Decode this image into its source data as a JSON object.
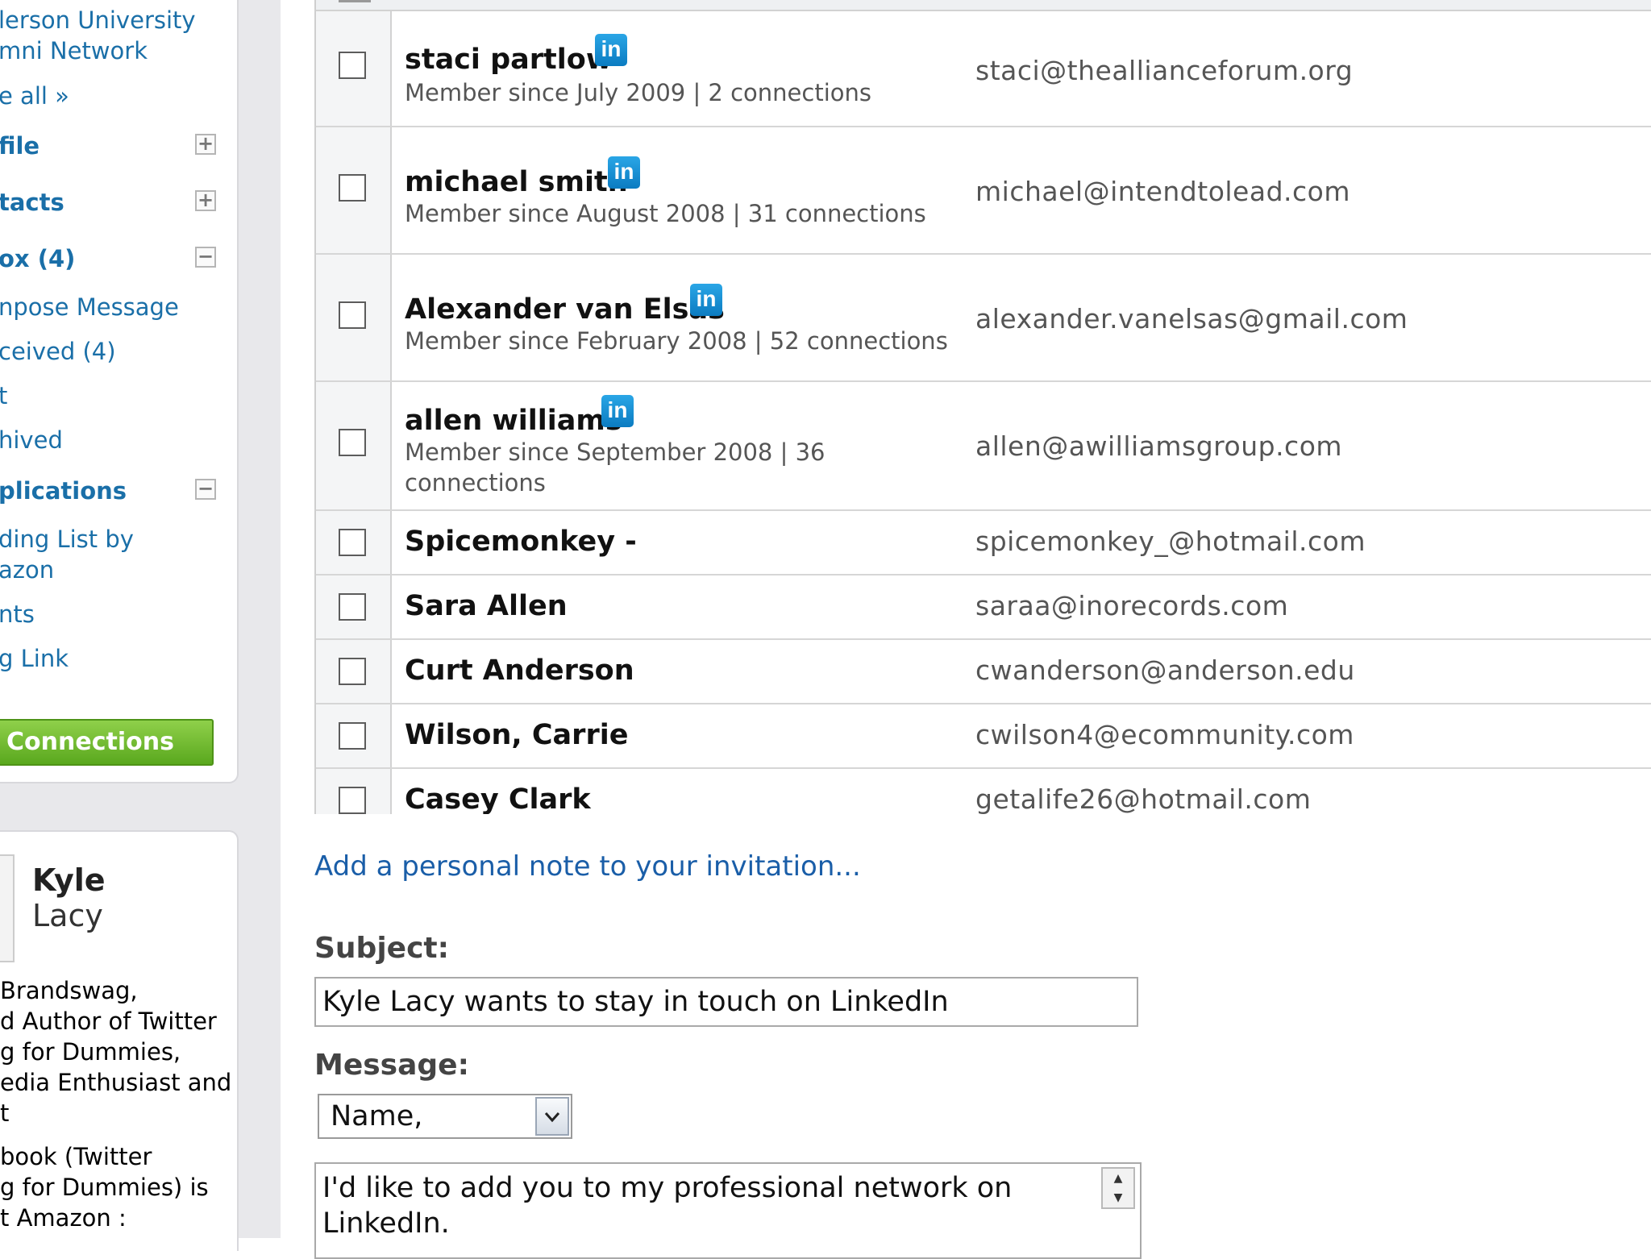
{
  "sidebar": {
    "network_line1": "lerson University",
    "network_line2": "mni Network",
    "see_all": "e all »",
    "sections": [
      {
        "label": "file",
        "toggle": "+"
      },
      {
        "label": "tacts",
        "toggle": "+"
      },
      {
        "label": "ox (4)",
        "toggle": "−"
      }
    ],
    "inbox_items": [
      "npose Message",
      "ceived (4)",
      "t",
      "hived"
    ],
    "applications": {
      "label": "plications",
      "toggle": "−"
    },
    "app_items": [
      "ding List by",
      "azon",
      "nts",
      "g Link"
    ],
    "connections_button": "Connections"
  },
  "profile": {
    "first_name": "Kyle",
    "last_name": "Lacy",
    "desc_lines": [
      "Brandswag,",
      "d Author of Twitter",
      "g for Dummies,",
      "edia Enthusiast and",
      "t"
    ],
    "book_lines": [
      "book (Twitter",
      "g for Dummies) is",
      "t Amazon :"
    ]
  },
  "contacts": [
    {
      "name": "staci partlow",
      "linkedin": true,
      "meta": "Member since July 2009  |  2 connections",
      "email": "staci@theallianceforum.org"
    },
    {
      "name": "michael smith",
      "linkedin": true,
      "meta": "Member since August 2008  |  31 connections",
      "email": "michael@intendtolead.com"
    },
    {
      "name": "Alexander van Elsas",
      "linkedin": true,
      "meta": "Member since February 2008  |  52 connections",
      "email": "alexander.vanelsas@gmail.com"
    },
    {
      "name": "allen williams",
      "linkedin": true,
      "meta": "Member since September 2008  |  36",
      "meta2": "connections",
      "email": "allen@awilliamsgroup.com"
    },
    {
      "name": "Spicemonkey -",
      "email": "spicemonkey_@hotmail.com"
    },
    {
      "name": "Sara Allen",
      "email": "saraa@inorecords.com"
    },
    {
      "name": "Curt Anderson",
      "email": "cwanderson@anderson.edu"
    },
    {
      "name": "Wilson, Carrie",
      "email": "cwilson4@ecommunity.com"
    },
    {
      "name": "Casey Clark",
      "email": "getalife26@hotmail.com"
    }
  ],
  "linkedin_badge": "in",
  "form": {
    "note_link": "Add a personal note to your invitation...",
    "subject_label": "Subject:",
    "subject_value": "Kyle Lacy wants to stay in touch on LinkedIn",
    "message_label": "Message:",
    "greeting_selected": "Name,",
    "message_text": "I'd like to add you to my professional network on LinkedIn."
  },
  "colors": {
    "link": "#1a6fa8",
    "linkedin_blue": "#0b7bc1",
    "connections_green": "#5aa81e"
  },
  "icons": [
    "linkedin-icon",
    "expand-icon",
    "collapse-icon",
    "dropdown-arrow-icon",
    "scroll-arrows-icon"
  ]
}
